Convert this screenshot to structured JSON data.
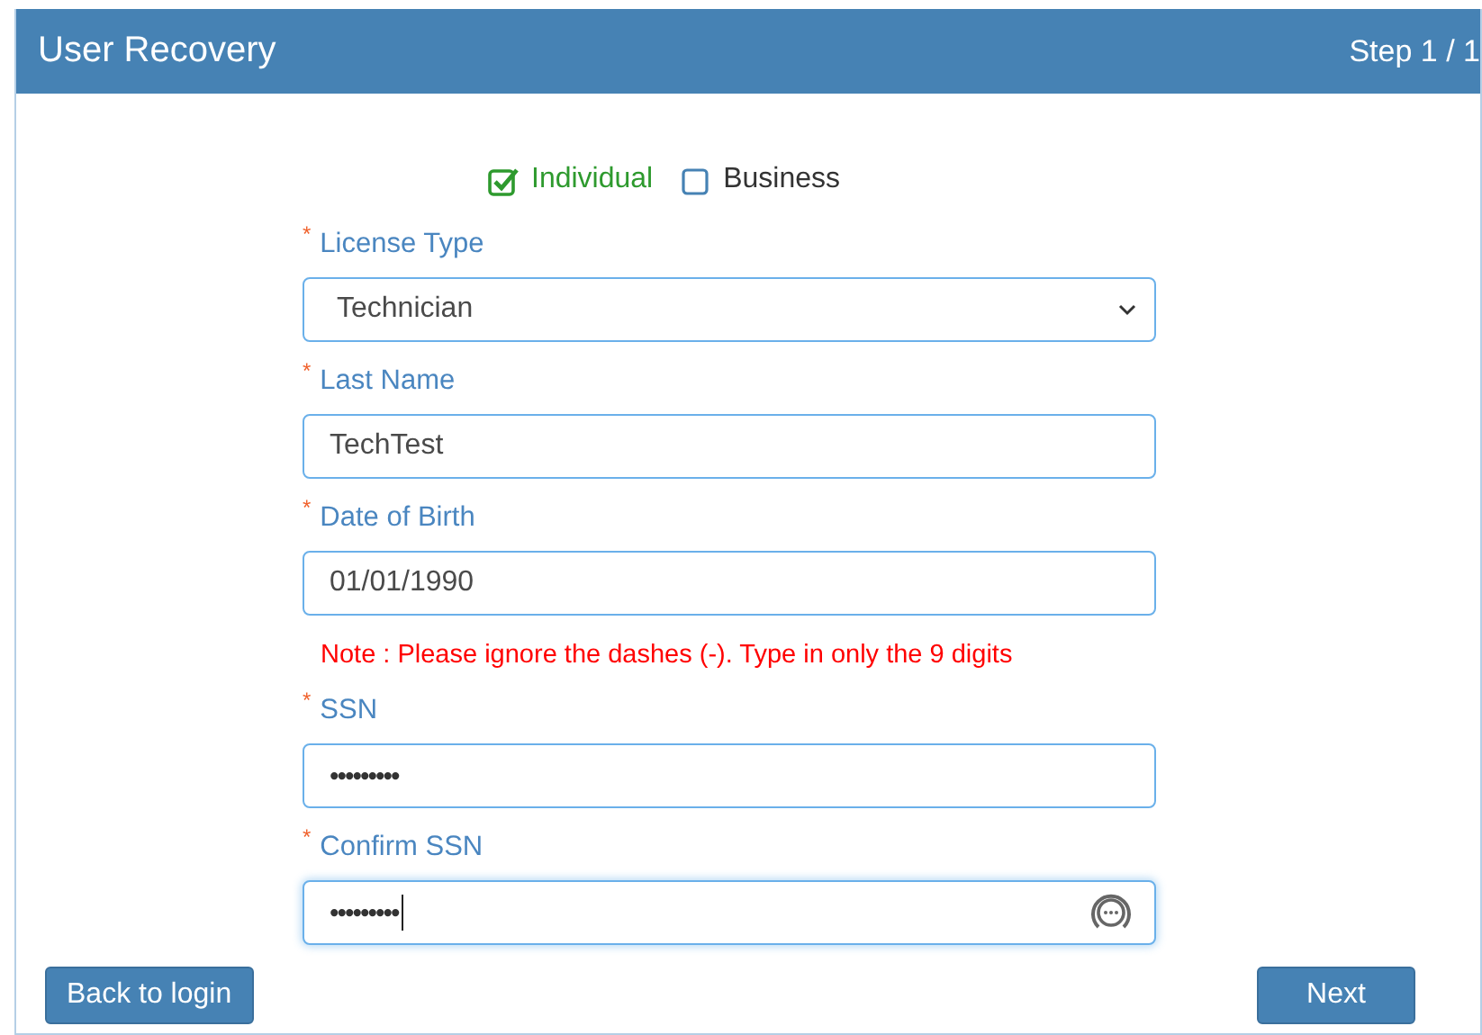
{
  "header": {
    "title": "User Recovery",
    "step": "Step 1 / 1"
  },
  "account_types": [
    {
      "label": "Individual",
      "checked": true
    },
    {
      "label": "Business",
      "checked": false
    }
  ],
  "form": [
    {
      "kind": "select",
      "label": "License Type",
      "required_mark": "*",
      "value": "Technician"
    },
    {
      "kind": "text",
      "label": "Last Name",
      "required_mark": "*",
      "value": "TechTest"
    },
    {
      "kind": "text",
      "label": "Date of Birth",
      "required_mark": "*",
      "value": "01/01/1990"
    },
    {
      "kind": "note",
      "text": "Note : Please ignore the dashes (-). Type in only the 9 digits"
    },
    {
      "kind": "password",
      "label": "SSN",
      "required_mark": "*",
      "value": "•••••••••",
      "focused": false
    },
    {
      "kind": "password",
      "label": "Confirm SSN",
      "required_mark": "*",
      "value": "•••••••••",
      "focused": true
    }
  ],
  "buttons": [
    {
      "label": "Back to login"
    },
    {
      "label": "Next"
    }
  ]
}
